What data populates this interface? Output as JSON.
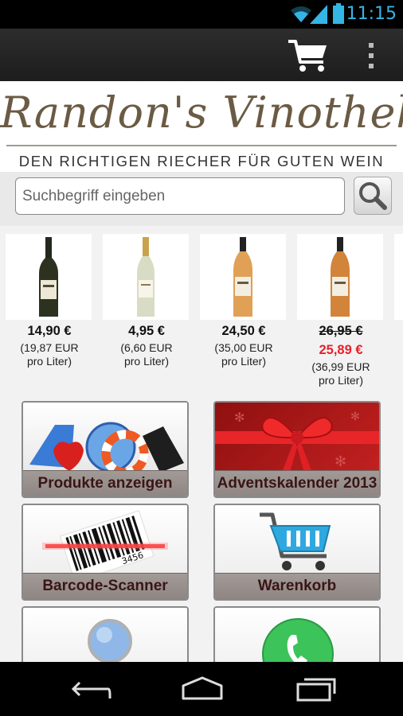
{
  "status_bar": {
    "time": "11:15"
  },
  "logo": {
    "title": "Randon's Vinothek",
    "tagline": "DEN RICHTIGEN RIECHER FÜR GUTEN WEIN"
  },
  "search": {
    "placeholder": "Suchbegriff eingeben"
  },
  "products": [
    {
      "price": "14,90 €",
      "unit_line1": "(19,87 EUR",
      "unit_line2": "pro Liter)"
    },
    {
      "price": "4,95 €",
      "unit_line1": "(6,60 EUR",
      "unit_line2": "pro Liter)"
    },
    {
      "price": "24,50 €",
      "unit_line1": "(35,00 EUR",
      "unit_line2": "pro Liter)"
    },
    {
      "old_price": "26,95 €",
      "price": "25,89 €",
      "unit_line1": "(36,99 EUR",
      "unit_line2": "pro Liter)"
    }
  ],
  "tiles": [
    {
      "label": "Produkte anzeigen",
      "icon": "products-icon"
    },
    {
      "label": "Adventskalender 2013",
      "icon": "gift-bow-icon"
    },
    {
      "label": "Barcode-Scanner",
      "icon": "barcode-icon",
      "barcode_digits": "3456"
    },
    {
      "label": "Warenkorb",
      "icon": "shopping-cart-icon"
    },
    {
      "label": "",
      "icon": "magnifier-icon"
    },
    {
      "label": "",
      "icon": "phone-icon"
    }
  ],
  "colors": {
    "accent": "#33b5e5",
    "sale": "#e8202a",
    "tile_label": "#3a1515"
  }
}
